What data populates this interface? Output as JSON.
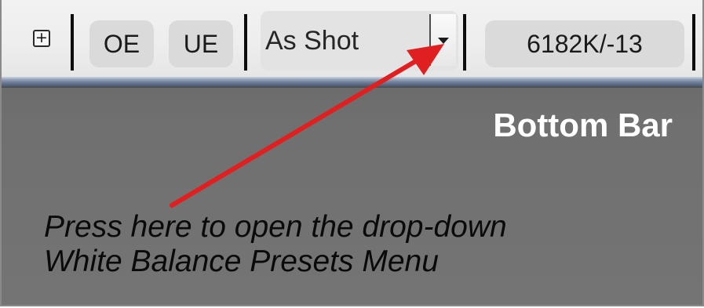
{
  "toolbar": {
    "zoom_in_icon": "plus-box-icon",
    "zoom_in_glyph": "+",
    "oe_label": "OE",
    "ue_label": "UE",
    "white_balance": {
      "selected": "As Shot",
      "dropdown_icon": "triangle-down-icon"
    },
    "temperature_tint": "6182K/-13"
  },
  "annotations": {
    "area_label": "Bottom Bar",
    "callout_line1": "Press here to open the drop-down",
    "callout_line2": "White Balance Presets Menu"
  },
  "colors": {
    "arrow": "#e02020",
    "panel": "#6e6e6e",
    "toolbar": "#eeeeee"
  }
}
